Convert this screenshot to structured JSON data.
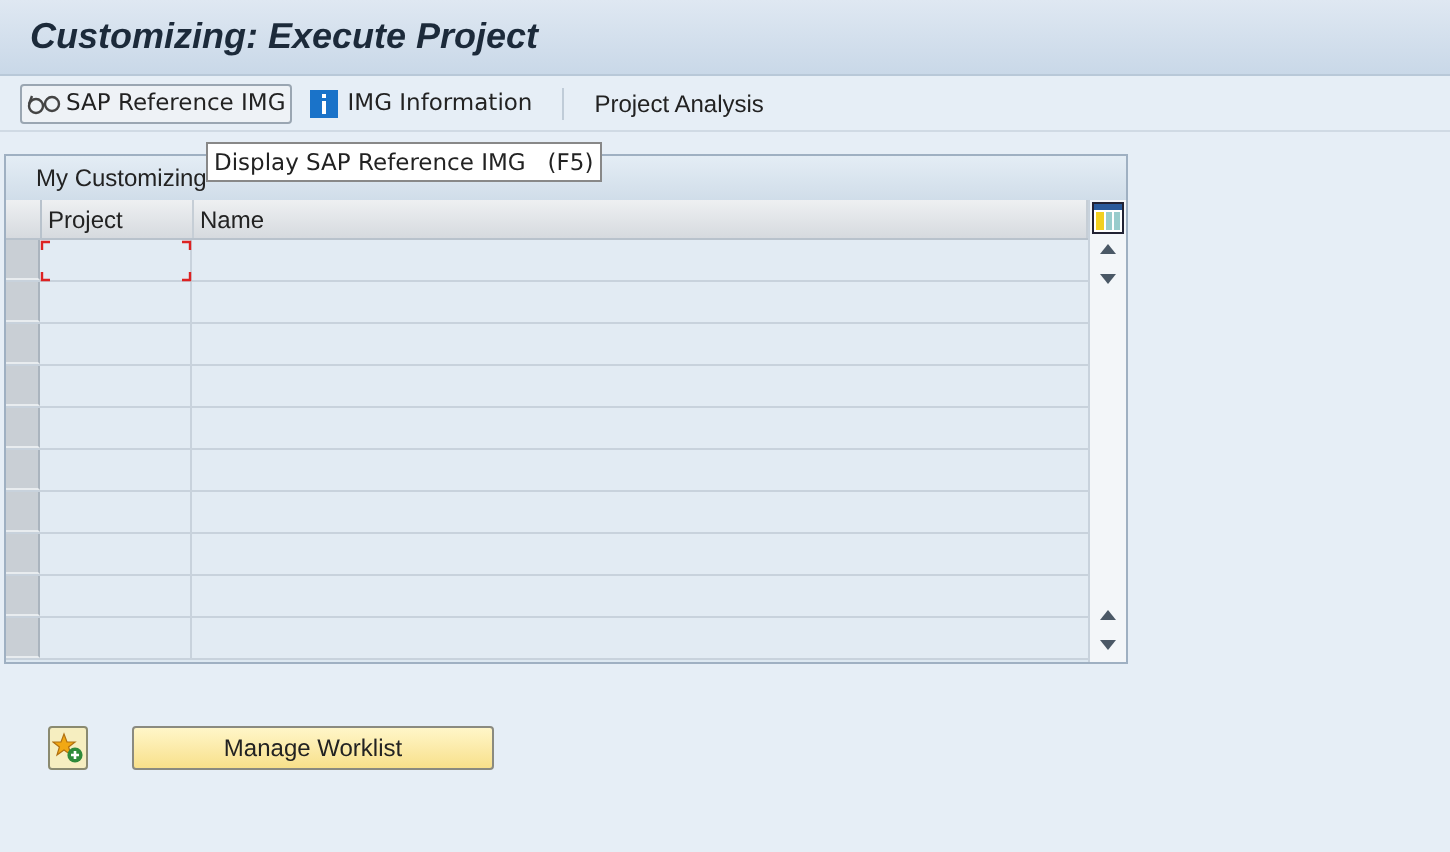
{
  "window": {
    "title": "Customizing: Execute Project"
  },
  "toolbar": [
    {
      "kind": "glasses",
      "label": "SAP Reference IMG",
      "selected": true
    },
    {
      "kind": "info",
      "label": "IMG Information",
      "selected": false
    },
    {
      "kind": "plain",
      "label": "Project Analysis",
      "selected": false
    }
  ],
  "tooltip": {
    "text": "Display SAP Reference IMG   (F5)"
  },
  "worklist": {
    "title": "My Customizing",
    "columns": [
      "Project",
      "Name"
    ]
  },
  "footer": {
    "button": "Manage Worklist"
  }
}
